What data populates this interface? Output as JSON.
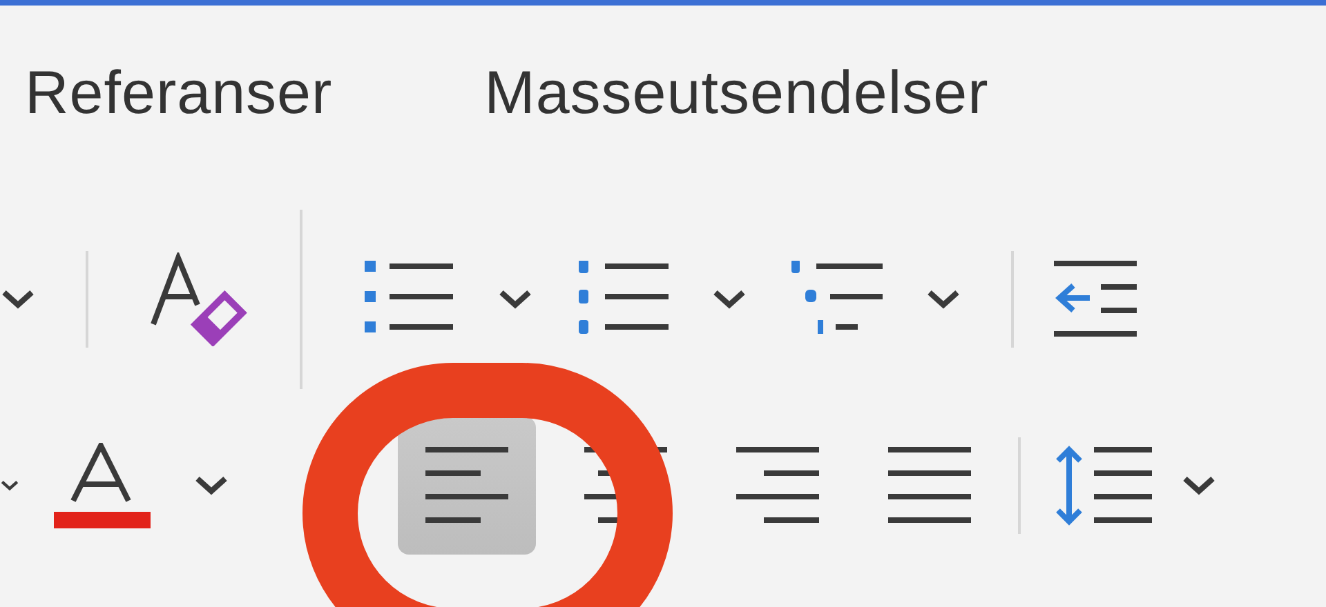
{
  "tabs": [
    {
      "label": "Referanser"
    },
    {
      "label": "Masseutsendelser"
    }
  ],
  "alignment": [
    {
      "kind": "left",
      "selected": true
    },
    {
      "kind": "center",
      "selected": false
    },
    {
      "kind": "right",
      "selected": false
    },
    {
      "kind": "justify",
      "selected": false
    }
  ]
}
